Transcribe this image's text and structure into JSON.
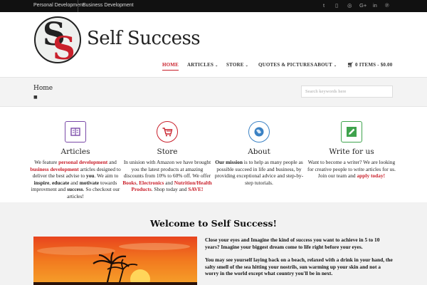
{
  "topbar": {
    "links": [
      "Personal Development",
      "Business Development"
    ],
    "social": [
      {
        "icon": "twitter-icon",
        "glyph": "t"
      },
      {
        "icon": "instagram-icon",
        "glyph": "◎"
      },
      {
        "icon": "google-plus-icon",
        "glyph": "G+"
      },
      {
        "icon": "linkedin-icon",
        "glyph": "in"
      },
      {
        "icon": "pinterest-icon",
        "glyph": "℗"
      }
    ]
  },
  "header": {
    "brand": "Self Success",
    "nav": [
      {
        "label": "HOME",
        "active": true,
        "dropdown": false
      },
      {
        "label": "ARTICLES",
        "active": false,
        "dropdown": true
      },
      {
        "label": "STORE",
        "active": false,
        "dropdown": true
      },
      {
        "label": "QUOTES & PICTURES",
        "active": false,
        "dropdown": false
      },
      {
        "label": "ABOUT",
        "active": false,
        "dropdown": true
      },
      {
        "label": "0 ITEMS - $0.00",
        "active": false,
        "dropdown": false,
        "icon": "cart-icon"
      }
    ],
    "accent": "#c9202b"
  },
  "breadcrumb": {
    "title": "Home",
    "search_placeholder": "Search keywords here"
  },
  "features": [
    {
      "title": "Articles",
      "icon": "book-icon",
      "color": "#7a4aa8",
      "text": [
        {
          "t": "We feature "
        },
        {
          "t": "personal development",
          "s": "red"
        },
        {
          "t": " and "
        },
        {
          "t": "business development",
          "s": "red"
        },
        {
          "t": " articles designed to deliver the best advise to "
        },
        {
          "t": "you",
          "s": "b"
        },
        {
          "t": ". We aim to "
        },
        {
          "t": "inspire",
          "s": "b"
        },
        {
          "t": ", "
        },
        {
          "t": "educate",
          "s": "b"
        },
        {
          "t": " and "
        },
        {
          "t": "motivate",
          "s": "b"
        },
        {
          "t": "  towards improvment and "
        },
        {
          "t": "success",
          "s": "b"
        },
        {
          "t": ". So checkout our articles!"
        }
      ]
    },
    {
      "title": "Store",
      "icon": "shopping-cart-icon",
      "color": "#c9202b",
      "text": [
        {
          "t": "In unision with Amazon we have brought you the latest products at amazing discounts from 10% to 60% off. We offer "
        },
        {
          "t": "Books",
          "s": "red"
        },
        {
          "t": ", "
        },
        {
          "t": "Electronics",
          "s": "red"
        },
        {
          "t": " and "
        },
        {
          "t": "Nutrition/Health Products",
          "s": "red"
        },
        {
          "t": ". Shop today and "
        },
        {
          "t": "SAVE!",
          "s": "red"
        }
      ]
    },
    {
      "title": "About",
      "icon": "globe-icon",
      "color": "#3b82c4",
      "text": [
        {
          "t": "Our mission",
          "s": "b"
        },
        {
          "t": " is to help as many people as possible succeed in life and business, by providing exceptional advice and step-by-step tutorials."
        }
      ]
    },
    {
      "title": "Write for us",
      "icon": "pencil-icon",
      "color": "#3fa34d",
      "text": [
        {
          "t": "Want to become a writer? We are looking for creative people to write articles for us. Join our team and "
        },
        {
          "t": "apply today!",
          "s": "red"
        }
      ]
    }
  ],
  "welcome": {
    "title": "Welcome to Self Success!",
    "paragraphs": [
      "Close your eyes and Imagine the kind of success you want to achieve in 5 to 10 years? Imagine your biggest dream come to life right before your eyes.",
      "You may see yourself laying back on a beach, relaxed with a drink in your hand, the salty smell of the sea hitting your nostrils, sun warming up your skin and not a worry in the world except what country you'll be in next."
    ]
  }
}
